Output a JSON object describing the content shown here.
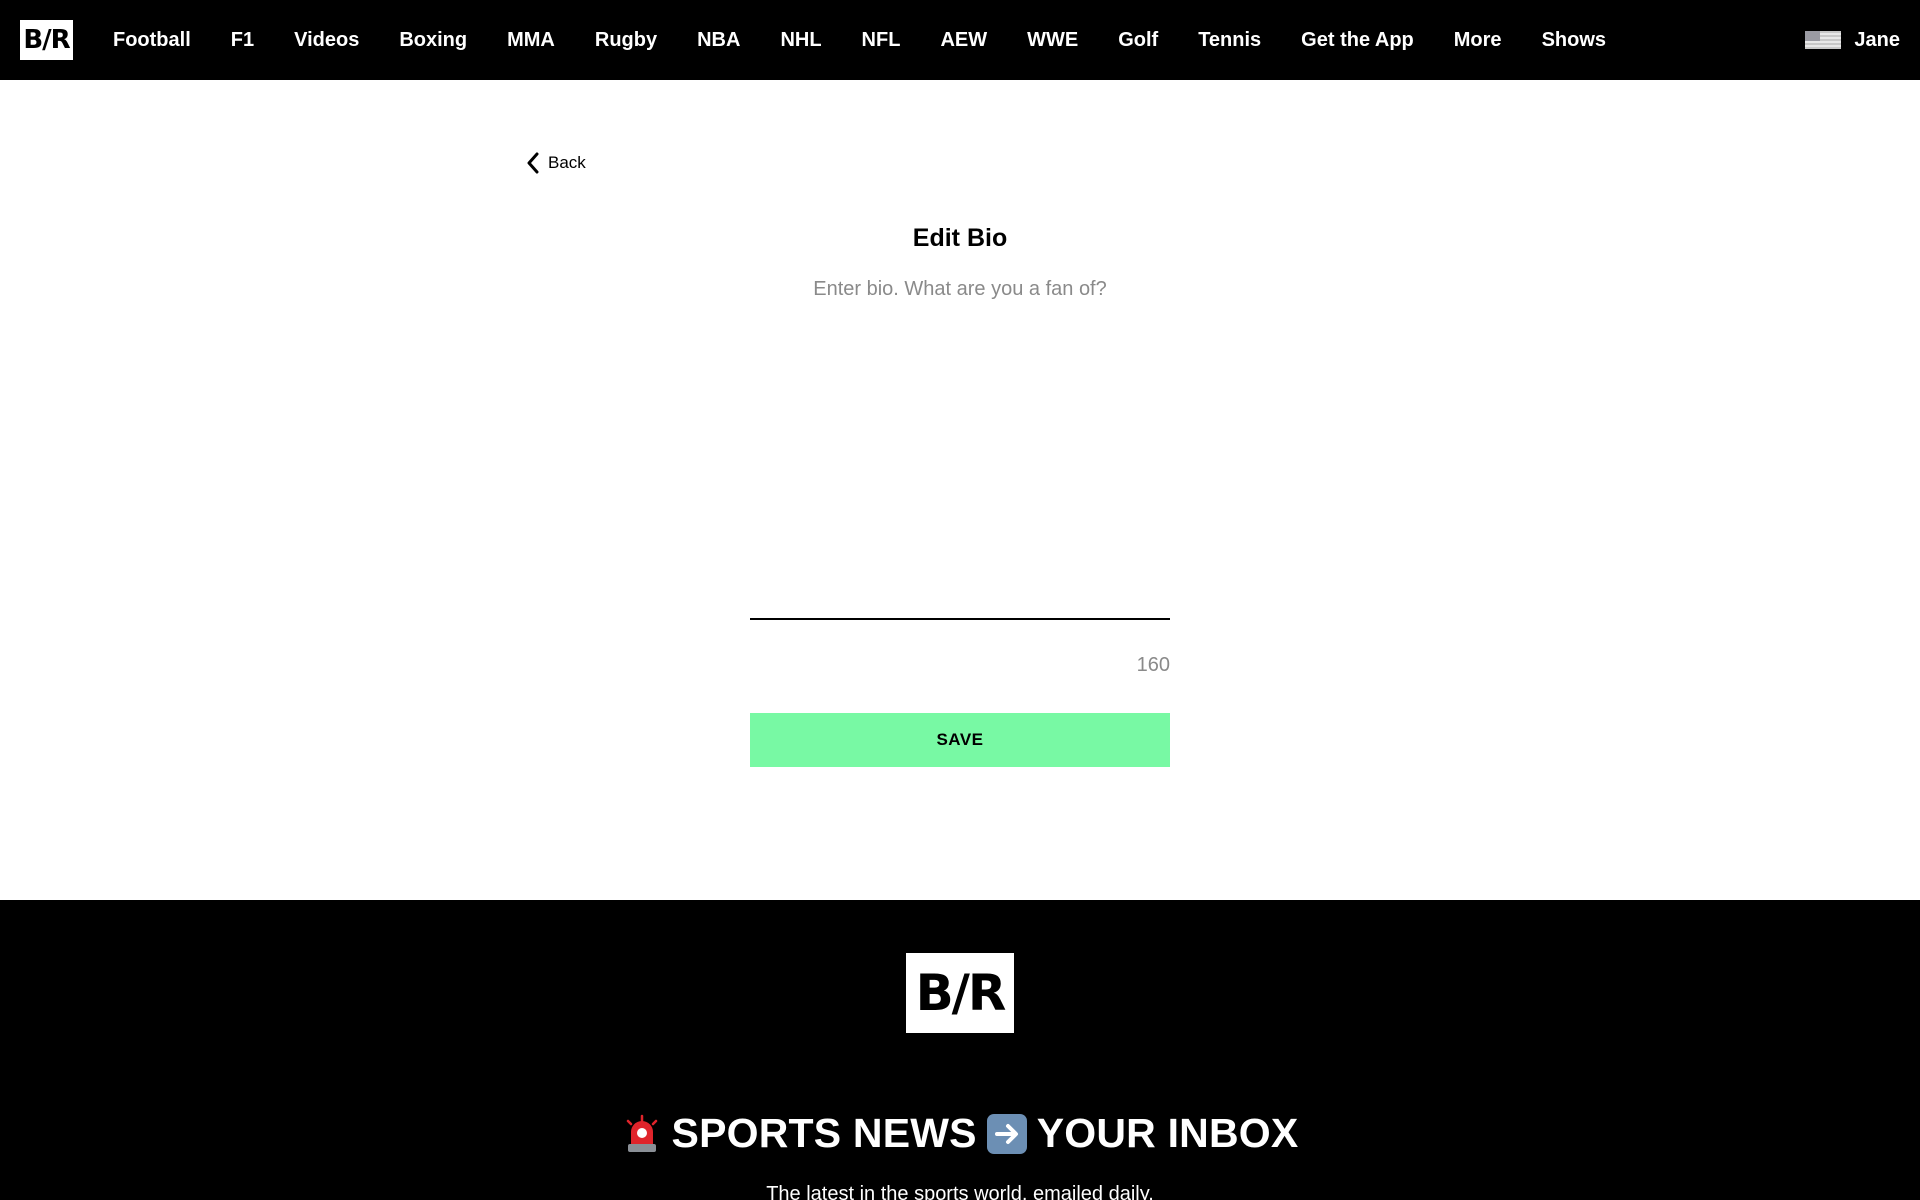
{
  "nav": {
    "logo": "B/R",
    "items": [
      {
        "label": "Football"
      },
      {
        "label": "F1"
      },
      {
        "label": "Videos"
      },
      {
        "label": "Boxing"
      },
      {
        "label": "MMA"
      },
      {
        "label": "Rugby"
      },
      {
        "label": "NBA"
      },
      {
        "label": "NHL"
      },
      {
        "label": "NFL"
      },
      {
        "label": "AEW"
      },
      {
        "label": "WWE"
      },
      {
        "label": "Golf"
      },
      {
        "label": "Tennis"
      },
      {
        "label": "Get the App"
      },
      {
        "label": "More"
      },
      {
        "label": "Shows"
      }
    ],
    "flag_icon": "us-flag-icon",
    "user_name": "Jane"
  },
  "main": {
    "back_label": "Back",
    "back_icon": "chevron-left-icon",
    "title": "Edit Bio",
    "bio_value": "",
    "bio_placeholder": "Enter bio. What are you a fan of?",
    "char_count": "160",
    "save_label": "SAVE"
  },
  "footer": {
    "logo": "B/R",
    "newsletter_left": "SPORTS NEWS",
    "newsletter_right": "YOUR INBOX",
    "newsletter_icons": [
      "siren-icon",
      "right-arrow-icon"
    ],
    "newsletter_sub": "The latest in the sports world, emailed daily."
  },
  "colors": {
    "nav_background": "#000000",
    "save_button": "#78f9a4",
    "placeholder_text": "#8a8a8a",
    "footer_background": "#000000"
  }
}
